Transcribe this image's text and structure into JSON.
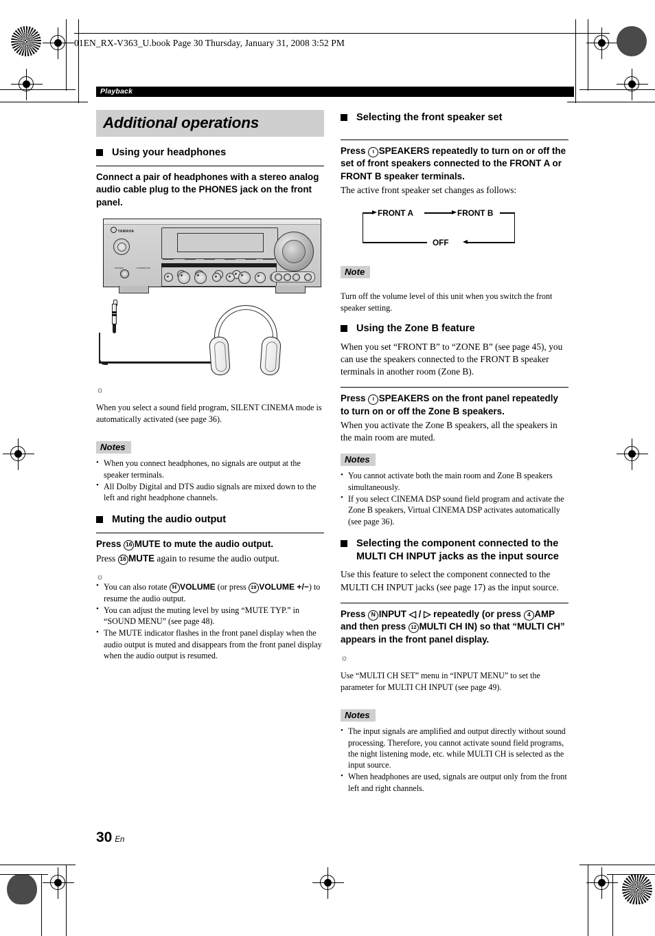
{
  "file_header": "01EN_RX-V363_U.book  Page 30  Thursday, January 31, 2008  3:52 PM",
  "chapter_tab": "Playback",
  "page_footer": {
    "number": "30",
    "lang": "En"
  },
  "left_column": {
    "section_title": "Additional operations",
    "headphones": {
      "heading": "Using your headphones",
      "instruction": "Connect a pair of headphones with a stereo analog audio cable plug to the PHONES jack on the front panel.",
      "illustration": {
        "brand": "YAMAHA",
        "phones_label": "PHONES",
        "standby_label": "STANDBY/ON"
      },
      "tip": "When you select a sound field program, SILENT CINEMA mode is automatically activated (see page 36).",
      "notes_label": "Notes",
      "notes": [
        "When you connect headphones, no signals are output at the speaker terminals.",
        "All Dolby Digital and DTS audio signals are mixed down to the left and right headphone channels."
      ]
    },
    "muting": {
      "heading": "Muting the audio output",
      "step_pre": "Press ",
      "step_num": "16",
      "step_key": "MUTE",
      "step_post": " to mute the audio output.",
      "followup_pre": "Press ",
      "followup_num": "16",
      "followup_key": "MUTE",
      "followup_post": " again to resume the audio output.",
      "tips": [
        {
          "parts": [
            {
              "t": "You can also rotate ",
              "s": "plain"
            },
            {
              "t": "H",
              "s": "circle"
            },
            {
              "t": "VOLUME",
              "s": "bold"
            },
            {
              "t": " (or press ",
              "s": "plain"
            },
            {
              "t": "19",
              "s": "circle"
            },
            {
              "t": "VOLUME +/−",
              "s": "bold"
            },
            {
              "t": ") to resume the audio output.",
              "s": "plain"
            }
          ]
        },
        {
          "parts": [
            {
              "t": "You can adjust the muting level by using “MUTE TYP.” in “SOUND MENU” (see page 48).",
              "s": "plain"
            }
          ]
        },
        {
          "parts": [
            {
              "t": "The MUTE indicator flashes in the front panel display when the audio output is muted and disappears from the front panel display when the audio output is resumed.",
              "s": "plain"
            }
          ]
        }
      ]
    }
  },
  "right_column": {
    "front_speaker": {
      "heading": "Selecting the front speaker set",
      "step_pre": "Press ",
      "step_num": "I",
      "step_key": "SPEAKERS",
      "step_post": " repeatedly to turn on or off the set of front speakers connected to the FRONT A or FRONT B speaker terminals.",
      "body": "The active front speaker set changes as follows:",
      "diagram": {
        "nodes": [
          "FRONT A",
          "FRONT B",
          "OFF"
        ],
        "flow": "FRONT A → FRONT B → OFF → FRONT A"
      },
      "note_label": "Note",
      "note": "Turn off the volume level of this unit when you switch the front speaker setting."
    },
    "zone_b": {
      "heading": "Using the Zone B feature",
      "body": "When you set “FRONT B” to “ZONE B” (see page 45), you can use the speakers connected to the FRONT B speaker terminals in another room (Zone B).",
      "step_pre": "Press ",
      "step_num": "I",
      "step_key": "SPEAKERS",
      "step_post": " on the front panel repeatedly to turn on or off the Zone B speakers.",
      "body2": "When you activate the Zone B speakers, all the speakers in the main room are muted.",
      "notes_label": "Notes",
      "notes": [
        "You cannot activate both the main room and Zone B speakers simultaneously.",
        "If you select CINEMA DSP sound field program and activate the Zone B speakers, Virtual CINEMA DSP activates automatically (see page 36)."
      ]
    },
    "multi_ch": {
      "heading": "Selecting the component connected to the MULTI CH INPUT jacks as the input source",
      "body": "Use this feature to select the component connected to the MULTI CH INPUT jacks (see page 17) as the input source.",
      "step_parts": [
        {
          "t": "Press ",
          "s": "bold"
        },
        {
          "t": "N",
          "s": "circle"
        },
        {
          "t": "INPUT ",
          "s": "bold"
        },
        {
          "t": "◁ / ▷",
          "s": "bold"
        },
        {
          "t": " repeatedly (or press ",
          "s": "bold"
        },
        {
          "t": "4",
          "s": "circle"
        },
        {
          "t": "AMP",
          "s": "bold"
        },
        {
          "t": " and then press ",
          "s": "bold"
        },
        {
          "t": "12",
          "s": "circle"
        },
        {
          "t": "MULTI CH IN",
          "s": "bold"
        },
        {
          "t": ") so that “MULTI CH” appears in the front panel display.",
          "s": "bold"
        }
      ],
      "tip": "Use “MULTI CH SET” menu in “INPUT MENU” to set the parameter for MULTI CH INPUT (see page 49).",
      "notes_label": "Notes",
      "notes": [
        "The input signals are amplified and output directly without sound processing. Therefore, you cannot activate sound field programs, the night listening mode, etc. while MULTI CH is selected as the input source.",
        "When headphones are used, signals are output only from the front left and right channels."
      ]
    }
  }
}
